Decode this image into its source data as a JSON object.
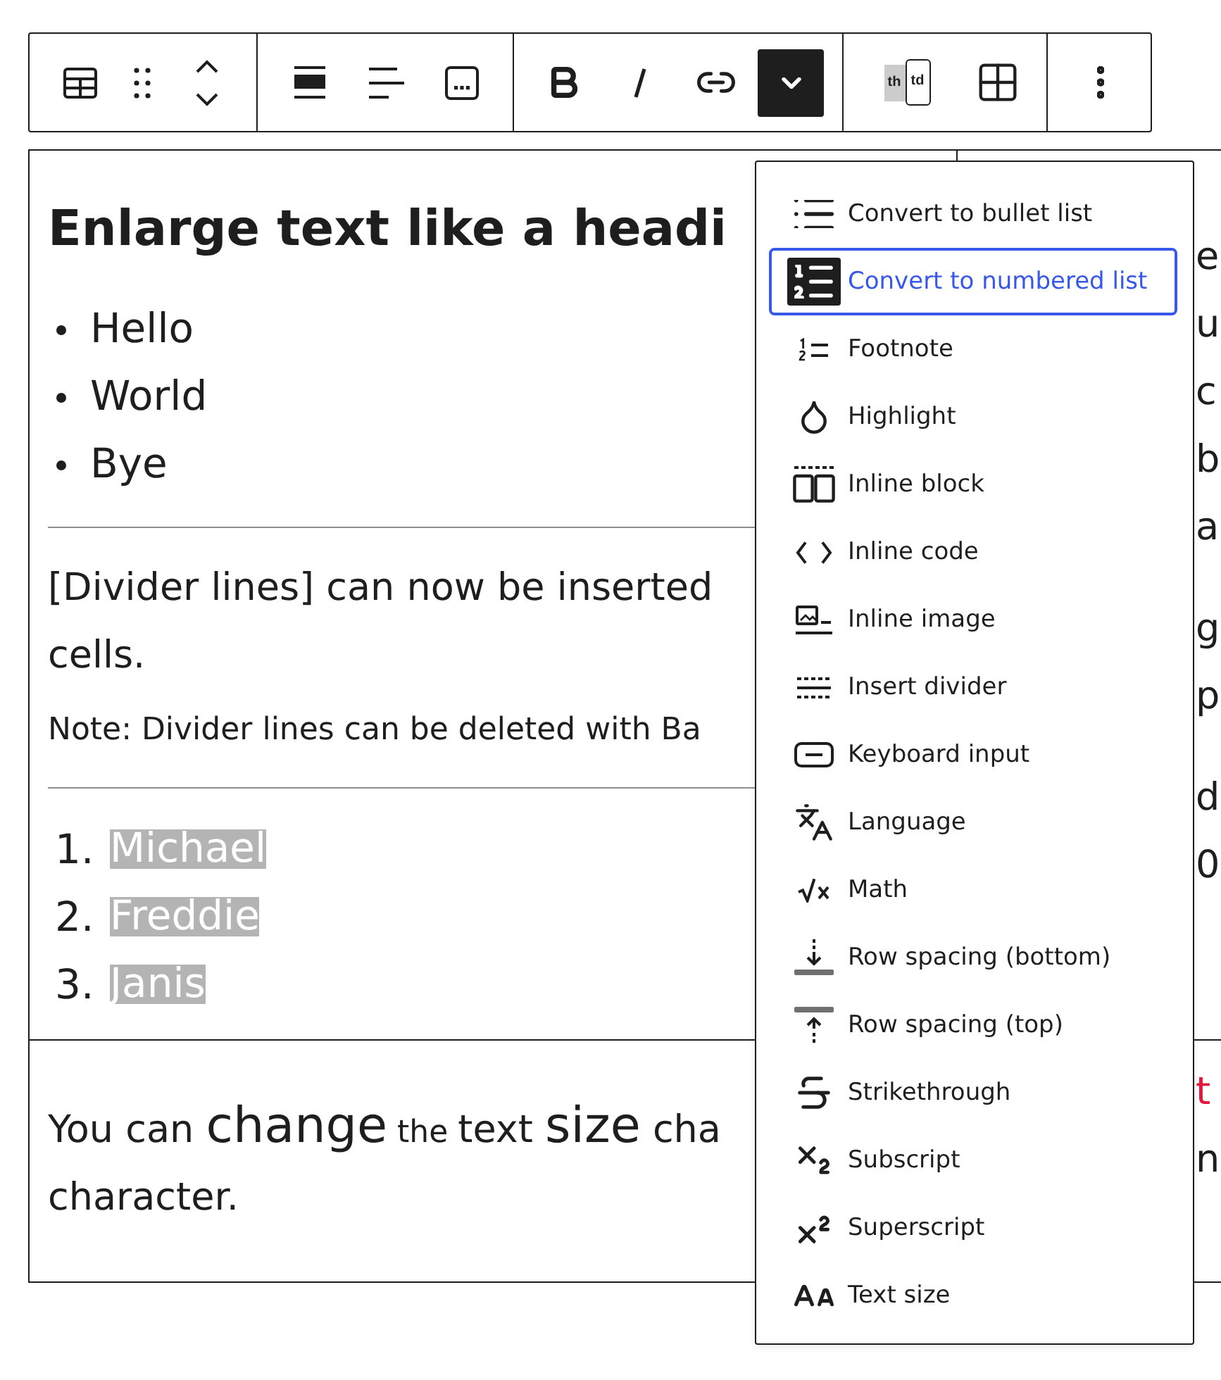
{
  "toolbar": {
    "groups": [
      {
        "buttons": [
          {
            "kind": "table",
            "active": false
          },
          {
            "kind": "drag",
            "active": false
          },
          {
            "kind": "move",
            "active": false
          }
        ]
      },
      {
        "buttons": [
          {
            "kind": "align_wide",
            "active": false
          },
          {
            "kind": "align_left",
            "active": false
          },
          {
            "kind": "caption",
            "active": false
          }
        ]
      },
      {
        "buttons": [
          {
            "kind": "bold",
            "active": false
          },
          {
            "kind": "italic",
            "active": false
          },
          {
            "kind": "link",
            "active": false
          },
          {
            "kind": "more",
            "active": true
          }
        ]
      },
      {
        "buttons": [
          {
            "kind": "cell_type",
            "active": false,
            "labels": [
              "th",
              "td"
            ]
          },
          {
            "kind": "cells",
            "active": false
          }
        ]
      },
      {
        "buttons": [
          {
            "kind": "options",
            "active": false
          }
        ]
      }
    ]
  },
  "table": {
    "rows": [
      {
        "cells": [
          {
            "blocks": [
              {
                "kind": "heading",
                "text": "Enlarge text like a headi"
              },
              {
                "kind": "bullet_list",
                "items": [
                  {
                    "text": "Hello"
                  },
                  {
                    "text": "World"
                  },
                  {
                    "text": "Bye"
                  }
                ]
              },
              {
                "kind": "divider"
              },
              {
                "kind": "paragraph",
                "lines": [
                  [
                    {
                      "kind": "normal",
                      "text": "[Divider lines] can now be inserted"
                    }
                  ],
                  [
                    {
                      "kind": "normal",
                      "text": "cells."
                    }
                  ]
                ]
              },
              {
                "kind": "paragraph",
                "lines": [
                  [
                    {
                      "kind": "small",
                      "text": "Note: Divider lines can be deleted with Ba"
                    }
                  ]
                ]
              },
              {
                "kind": "divider"
              },
              {
                "kind": "ordered_list",
                "items": [
                  {
                    "marker": "1.",
                    "text": "Michael",
                    "highlighted": true
                  },
                  {
                    "marker": "2.",
                    "text": "Freddie",
                    "highlighted": true
                  },
                  {
                    "marker": "3.",
                    "text": "Janis",
                    "highlighted": true
                  }
                ]
              }
            ]
          },
          {
            "blocks": [
              {
                "kind": "fragments",
                "lines": [
                  {
                    "text": "e"
                  },
                  {
                    "text": "u"
                  },
                  {
                    "text": "c"
                  },
                  {
                    "text": "b"
                  },
                  {
                    "text": "a"
                  }
                ]
              },
              {
                "kind": "fragments",
                "lines": [
                  {
                    "text": "g"
                  },
                  {
                    "text": "p"
                  }
                ]
              },
              {
                "kind": "fragments",
                "lines": [
                  {
                    "text": "d"
                  },
                  {
                    "text": "0"
                  }
                ]
              }
            ]
          }
        ]
      },
      {
        "cells": [
          {
            "blocks": [
              {
                "kind": "paragraph",
                "lines": [
                  [
                    {
                      "kind": "normal",
                      "text": "You can "
                    },
                    {
                      "kind": "large",
                      "text": "change"
                    },
                    {
                      "kind": "small",
                      "text": " the "
                    },
                    {
                      "kind": "normal",
                      "text": "text "
                    },
                    {
                      "kind": "large",
                      "text": "size"
                    },
                    {
                      "kind": "normal",
                      "text": " cha"
                    }
                  ],
                  [
                    {
                      "kind": "normal",
                      "text": "character."
                    }
                  ]
                ]
              }
            ]
          },
          {
            "blocks": [
              {
                "kind": "fragments",
                "lines": [
                  {
                    "text": "t",
                    "color": "#e3173c"
                  },
                  {
                    "text": "n"
                  }
                ]
              }
            ]
          }
        ]
      }
    ]
  },
  "format_menu": {
    "items": [
      {
        "kind": "bullet_list",
        "label": "Convert to bullet list",
        "selected": false
      },
      {
        "kind": "numbered_list",
        "label": "Convert to numbered list",
        "selected": true
      },
      {
        "kind": "footnote",
        "label": "Footnote",
        "selected": false
      },
      {
        "kind": "highlight",
        "label": "Highlight",
        "selected": false
      },
      {
        "kind": "inline_block",
        "label": "Inline block",
        "selected": false
      },
      {
        "kind": "inline_code",
        "label": "Inline code",
        "selected": false
      },
      {
        "kind": "inline_image",
        "label": "Inline image",
        "selected": false
      },
      {
        "kind": "divider",
        "label": "Insert divider",
        "selected": false
      },
      {
        "kind": "keyboard",
        "label": "Keyboard input",
        "selected": false
      },
      {
        "kind": "language",
        "label": "Language",
        "selected": false
      },
      {
        "kind": "math",
        "label": "Math",
        "selected": false
      },
      {
        "kind": "spacing_bottom",
        "label": "Row spacing (bottom)",
        "selected": false
      },
      {
        "kind": "spacing_top",
        "label": "Row spacing (top)",
        "selected": false
      },
      {
        "kind": "strikethrough",
        "label": "Strikethrough",
        "selected": false
      },
      {
        "kind": "subscript",
        "label": "Subscript",
        "selected": false
      },
      {
        "kind": "superscript",
        "label": "Superscript",
        "selected": false
      },
      {
        "kind": "text_size",
        "label": "Text size",
        "selected": false
      }
    ]
  }
}
